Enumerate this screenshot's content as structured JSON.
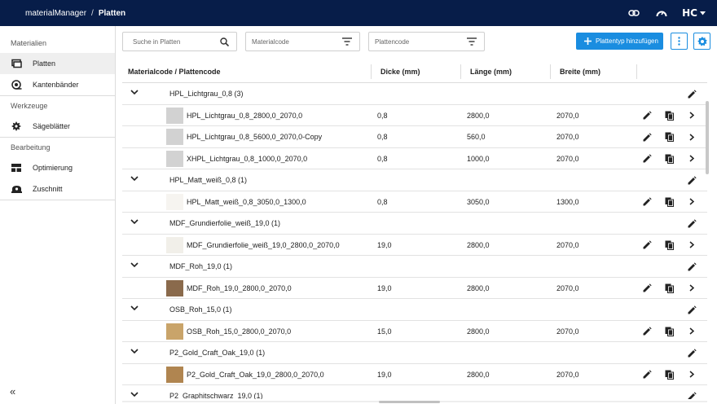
{
  "header": {
    "app_name": "materialManager",
    "separator": "/",
    "page": "Platten",
    "logo_text": "HC"
  },
  "sidebar": {
    "sections": [
      {
        "title": "Materialien",
        "items": [
          {
            "label": "Platten",
            "icon": "panel-icon",
            "active": true
          },
          {
            "label": "Kantenbänder",
            "icon": "edge-band-icon",
            "active": false
          }
        ]
      },
      {
        "title": "Werkzeuge",
        "items": [
          {
            "label": "Sägeblätter",
            "icon": "saw-blade-icon",
            "active": false
          }
        ]
      },
      {
        "title": "Bearbeitung",
        "items": [
          {
            "label": "Optimierung",
            "icon": "optimization-icon",
            "active": false
          },
          {
            "label": "Zuschnitt",
            "icon": "cutting-icon",
            "active": false
          }
        ]
      }
    ],
    "collapse_label": "«"
  },
  "toolbar": {
    "search_placeholder": "Suche in Platten",
    "material_filter_placeholder": "Materialcode",
    "plate_filter_placeholder": "Plattencode",
    "add_label": "Plattentyp hinzufügen",
    "accent": "#1a8de0"
  },
  "table": {
    "columns": [
      "Materialcode / Plattencode",
      "Dicke (mm)",
      "Länge (mm)",
      "Breite (mm)"
    ],
    "groups": [
      {
        "name": "HPL_Lichtgrau_0,8 (3)",
        "plates": [
          {
            "code": "HPL_Lichtgrau_0,8_2800,0_2070,0",
            "dicke": "0,8",
            "laenge": "2800,0",
            "breite": "2070,0",
            "swatch": "#d2d2d2"
          },
          {
            "code": "HPL_Lichtgrau_0,8_5600,0_2070,0-Copy",
            "dicke": "0,8",
            "laenge": "560,0",
            "breite": "2070,0",
            "swatch": "#d2d2d2"
          },
          {
            "code": "XHPL_Lichtgrau_0,8_1000,0_2070,0",
            "dicke": "0,8",
            "laenge": "1000,0",
            "breite": "2070,0",
            "swatch": "#d2d2d2"
          }
        ]
      },
      {
        "name": "HPL_Matt_weiß_0,8 (1)",
        "plates": [
          {
            "code": "HPL_Matt_weiß_0,8_3050,0_1300,0",
            "dicke": "0,8",
            "laenge": "3050,0",
            "breite": "1300,0",
            "swatch": "#f6f4f0"
          }
        ]
      },
      {
        "name": "MDF_Grundierfolie_weiß_19,0 (1)",
        "plates": [
          {
            "code": "MDF_Grundierfolie_weiß_19,0_2800,0_2070,0",
            "dicke": "19,0",
            "laenge": "2800,0",
            "breite": "2070,0",
            "swatch": "#f1efe9"
          }
        ]
      },
      {
        "name": "MDF_Roh_19,0 (1)",
        "plates": [
          {
            "code": "MDF_Roh_19,0_2800,0_2070,0",
            "dicke": "19,0",
            "laenge": "2800,0",
            "breite": "2070,0",
            "swatch": "#8a6a4c"
          }
        ]
      },
      {
        "name": "OSB_Roh_15,0 (1)",
        "plates": [
          {
            "code": "OSB_Roh_15,0_2800,0_2070,0",
            "dicke": "15,0",
            "laenge": "2800,0",
            "breite": "2070,0",
            "swatch": "#c9a46a"
          }
        ]
      },
      {
        "name": "P2_Gold_Craft_Oak_19,0 (1)",
        "plates": [
          {
            "code": "P2_Gold_Craft_Oak_19,0_2800,0_2070,0",
            "dicke": "19,0",
            "laenge": "2800,0",
            "breite": "2070,0",
            "swatch": "#b08550"
          }
        ]
      },
      {
        "name": "P2_Graphitschwarz_19,0 (1)",
        "plates": []
      }
    ]
  }
}
